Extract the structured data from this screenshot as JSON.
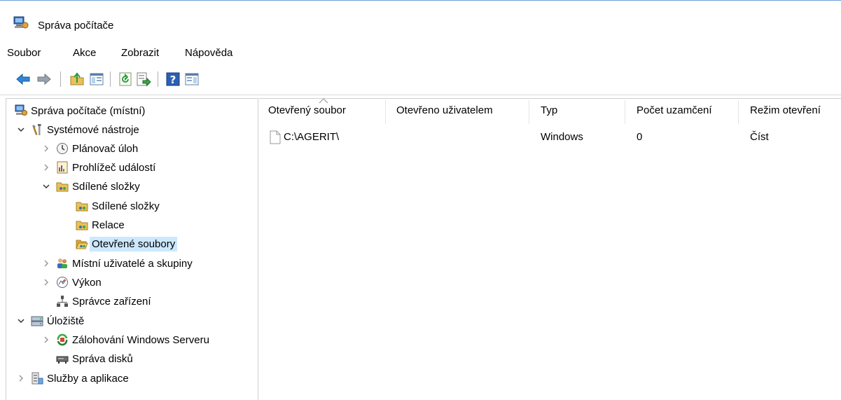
{
  "window": {
    "title": "Správa počítače"
  },
  "menu": [
    "Soubor",
    "Akce",
    "Zobrazit",
    "Nápověda"
  ],
  "toolbar": {
    "buttons": [
      "back-arrow-icon",
      "forward-arrow-icon",
      "up-folder-icon",
      "show-hide-tree-icon",
      "refresh-icon",
      "export-list-icon",
      "help-icon",
      "show-hide-action-pane-icon"
    ]
  },
  "tree": {
    "root": "Správa počítače (místní)",
    "system_tools": "Systémové nástroje",
    "task_scheduler": "Plánovač úloh",
    "event_viewer": "Prohlížeč událostí",
    "shared_folders": "Sdílené složky",
    "shares": "Sdílené složky",
    "sessions": "Relace",
    "open_files": "Otevřené soubory",
    "local_users": "Místní uživatelé a skupiny",
    "performance": "Výkon",
    "device_manager": "Správce zařízení",
    "storage": "Úložiště",
    "backup": "Zálohování Windows Serveru",
    "disk_management": "Správa disků",
    "services": "Služby a aplikace"
  },
  "list": {
    "columns": [
      "Otevřený soubor",
      "Otevřeno uživatelem",
      "Typ",
      "Počet uzamčení",
      "Režim otevření"
    ],
    "rows": [
      {
        "file": "C:\\AGERIT\\",
        "user": "",
        "type": "Windows",
        "locks": "0",
        "mode": "Číst"
      }
    ]
  },
  "colors": {
    "selection": "#cce8ff",
    "accent": "#3c7fd0"
  }
}
